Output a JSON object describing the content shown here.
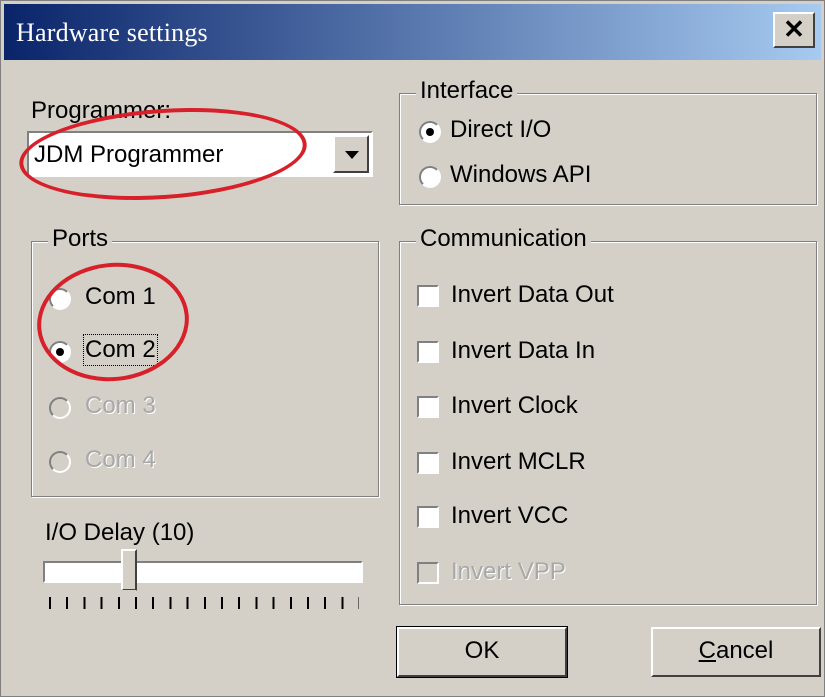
{
  "window": {
    "title": "Hardware settings",
    "close_label": "✕"
  },
  "programmer": {
    "label": "Programmer:",
    "value": "JDM Programmer"
  },
  "interface": {
    "legend": "Interface",
    "options": [
      {
        "label": "Direct I/O",
        "selected": true
      },
      {
        "label": "Windows API",
        "selected": false
      }
    ]
  },
  "ports": {
    "legend": "Ports",
    "options": [
      {
        "label": "Com 1",
        "selected": false,
        "enabled": true
      },
      {
        "label": "Com 2",
        "selected": true,
        "enabled": true
      },
      {
        "label": "Com 3",
        "selected": false,
        "enabled": false
      },
      {
        "label": "Com 4",
        "selected": false,
        "enabled": false
      }
    ]
  },
  "communication": {
    "legend": "Communication",
    "options": [
      {
        "label": "Invert Data Out",
        "checked": false,
        "enabled": true
      },
      {
        "label": "Invert Data In",
        "checked": false,
        "enabled": true
      },
      {
        "label": "Invert Clock",
        "checked": false,
        "enabled": true
      },
      {
        "label": "Invert MCLR",
        "checked": false,
        "enabled": true
      },
      {
        "label": "Invert VCC",
        "checked": false,
        "enabled": true
      },
      {
        "label": "Invert VPP",
        "checked": false,
        "enabled": false
      }
    ]
  },
  "io_delay": {
    "label": "I/O Delay (10)",
    "value": 10,
    "max": 100
  },
  "buttons": {
    "ok": "OK",
    "cancel_prefix": "C",
    "cancel_rest": "ancel"
  },
  "colors": {
    "annotation": "#d8202a",
    "titlebar_start": "#0a246a",
    "titlebar_end": "#a6caf0",
    "face": "#d4d0c8"
  }
}
